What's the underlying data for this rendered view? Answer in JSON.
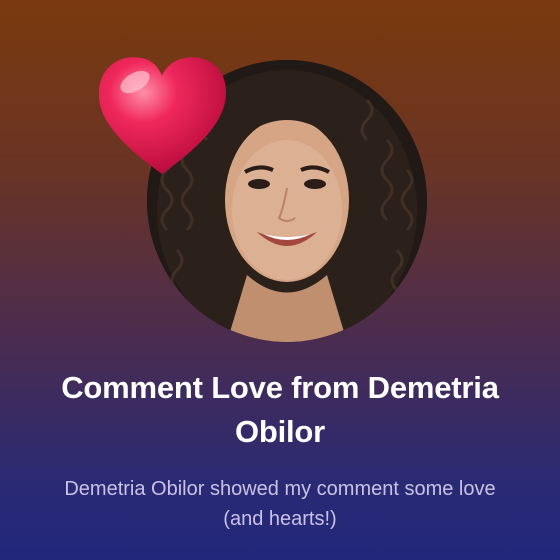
{
  "card": {
    "title": "Comment Love from Demetria Obilor",
    "subtitle": "Demetria Obilor showed my comment some love (and hearts!)"
  },
  "icons": {
    "heart": "heart-icon",
    "avatar": "profile-photo"
  },
  "colors": {
    "heart": "#e8174e",
    "title_text": "#ffffff",
    "subtitle_text": "#c9c2e6"
  }
}
